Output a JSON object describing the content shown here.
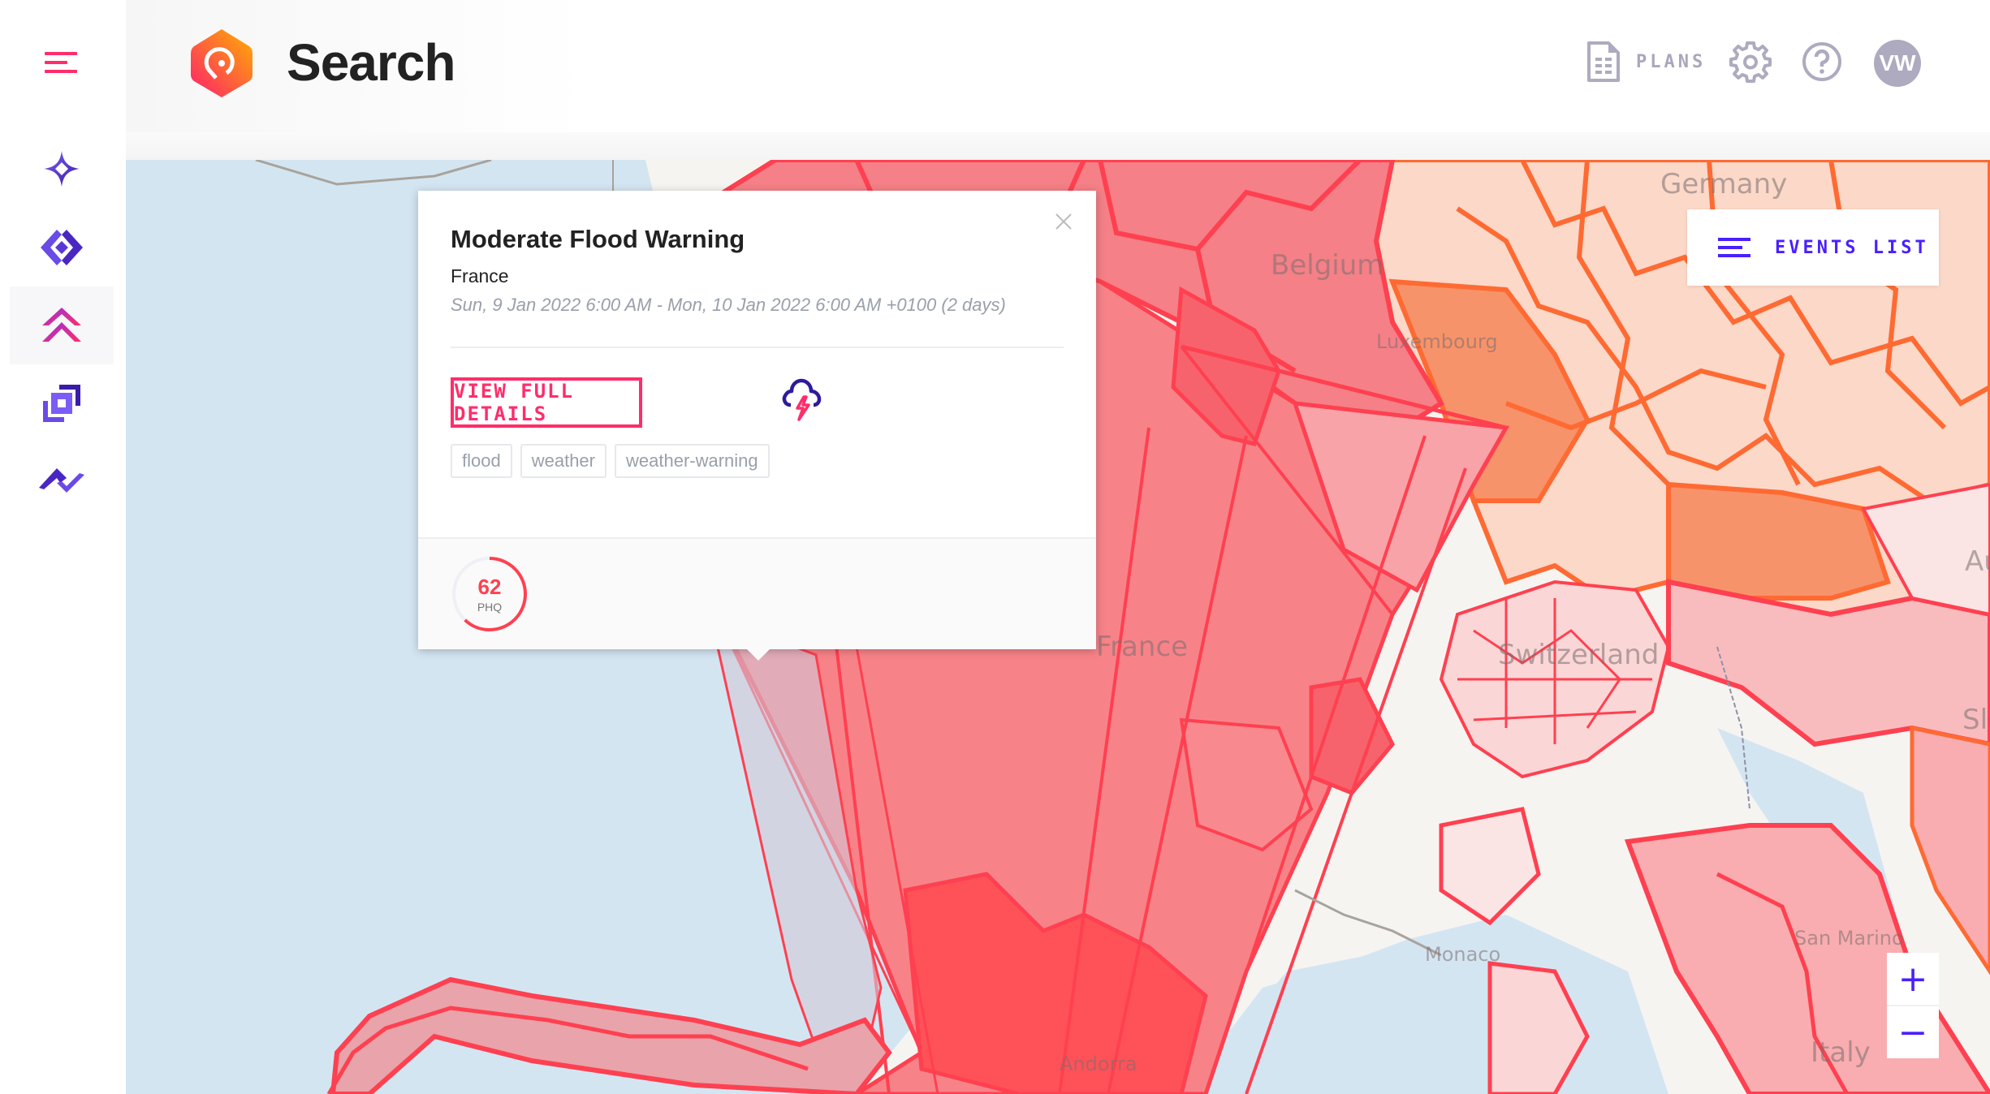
{
  "app": {
    "title": "Search",
    "logo_icon": "location-pin-hex-logo"
  },
  "sidebar": {
    "menu_icon": "hamburger-menu-icon",
    "items": [
      {
        "name": "sparkle-star-icon",
        "active": false
      },
      {
        "name": "diamond-code-icon",
        "active": false
      },
      {
        "name": "double-chevron-up-icon",
        "active": true
      },
      {
        "name": "layered-squares-icon",
        "active": false
      },
      {
        "name": "zigzag-wave-icon",
        "active": false
      }
    ]
  },
  "header": {
    "plans_label": "PLANS",
    "plans_icon": "document-icon",
    "settings_icon": "gear-icon",
    "help_icon": "help-circle-icon",
    "avatar_initials": "VW"
  },
  "events_list": {
    "label": "EVENTS LIST",
    "icon": "list-icon"
  },
  "zoom": {
    "in_label": "+",
    "out_label": "−"
  },
  "popup": {
    "title": "Moderate Flood Warning",
    "location": "France",
    "dates": "Sun, 9 Jan 2022 6:00 AM - Mon, 10 Jan 2022 6:00 AM +0100 (2 days)",
    "view_button": "VIEW FULL DETAILS",
    "category_icon": "storm-cloud-lightning-icon",
    "tags": [
      "flood",
      "weather",
      "weather-warning"
    ],
    "phq": {
      "value": "62",
      "label": "PHQ",
      "fraction": 0.62
    },
    "close_icon": "close-icon"
  },
  "map": {
    "labels": [
      "Germany",
      "Belgium",
      "Luxembourg",
      "France",
      "Switzerland",
      "Monaco",
      "San Marino",
      "Italy",
      "Andorra",
      "Au",
      "Slo"
    ]
  },
  "colors": {
    "accent_pink": "#ff2d6b",
    "accent_purple": "#4a1fff",
    "event_red": "#ff4050",
    "event_orange": "#ff6a33",
    "muted": "#aeaabf"
  }
}
